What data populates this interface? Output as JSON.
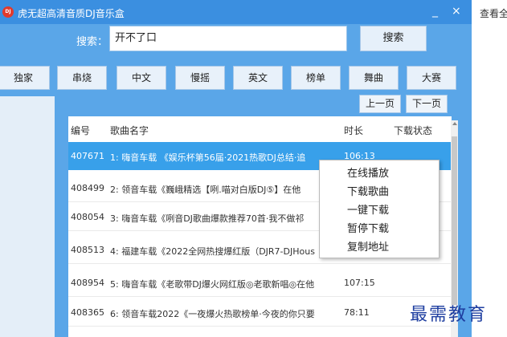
{
  "window": {
    "title": "虎无超高清音质DJ音乐盒",
    "minimize": "_",
    "close": "×",
    "logo_text": "DJ"
  },
  "search": {
    "label": "搜索：",
    "value": "开不了口",
    "button": "搜索"
  },
  "tabs": [
    "独家",
    "串烧",
    "中文",
    "慢摇",
    "英文",
    "榜单",
    "舞曲",
    "大赛"
  ],
  "pagination": {
    "prev": "上一页",
    "next": "下一页"
  },
  "list": {
    "headers": {
      "id": "编号",
      "name": "歌曲名字",
      "duration": "时长",
      "status": "下载状态"
    },
    "rows": [
      {
        "id": "407671",
        "name": "1: 嗨音车载 《娱乐杯第56届·2021热歌DJ总结·追",
        "duration": "106:13",
        "selected": true
      },
      {
        "id": "408499",
        "name": "2: 领音车载《巍峨精选【咧.喵对白版DJ⑤】在他",
        "duration": ""
      },
      {
        "id": "408054",
        "name": "3: 嗨音车载《咧音DJ歌曲爆款推荐70首·我不做祁",
        "duration": ""
      },
      {
        "id": "408513",
        "name": "4: 福建车载《2022全网热搜爆红版（DJR7-DJHous",
        "duration": ""
      },
      {
        "id": "408954",
        "name": "5: 嗨音车载《老歌带DJ爆火网红版◎老歌新唱◎在他",
        "duration": "107:15"
      },
      {
        "id": "408365",
        "name": "6: 领音车载2022《一夜爆火热歌榜单·今夜的你只要",
        "duration": "78:11"
      }
    ]
  },
  "context_menu": [
    "在线播放",
    "下载歌曲",
    "一键下载",
    "暂停下载",
    "复制地址"
  ],
  "side_link": "查看全",
  "watermark": "最需教育"
}
